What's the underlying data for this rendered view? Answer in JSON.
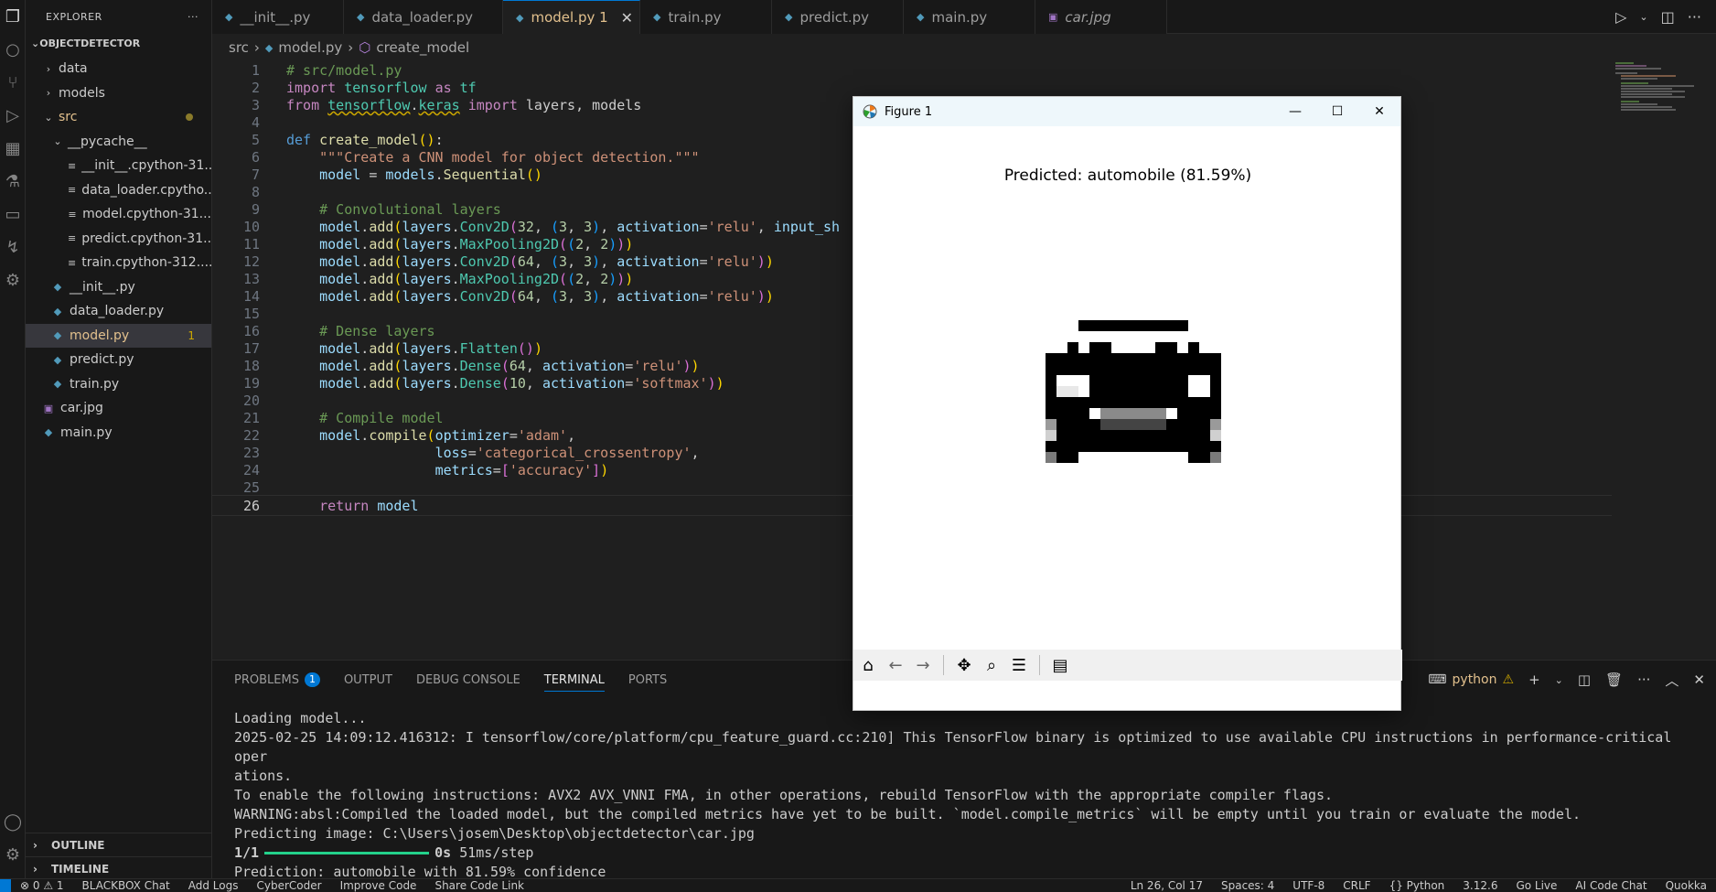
{
  "explorer": {
    "title": "EXPLORER",
    "more": "···",
    "root": "OBJECTDETECTOR",
    "items": [
      {
        "label": "data",
        "kind": "folder"
      },
      {
        "label": "models",
        "kind": "folder"
      },
      {
        "label": "src",
        "kind": "folder-open"
      },
      {
        "label": "__pycache__",
        "kind": "folder-open"
      },
      {
        "label": "__init__.cpython-31...",
        "kind": "file"
      },
      {
        "label": "data_loader.cpytho...",
        "kind": "file"
      },
      {
        "label": "model.cpython-31...",
        "kind": "file"
      },
      {
        "label": "predict.cpython-31...",
        "kind": "file"
      },
      {
        "label": "train.cpython-312....",
        "kind": "file"
      },
      {
        "label": "__init__.py",
        "kind": "py"
      },
      {
        "label": "data_loader.py",
        "kind": "py"
      },
      {
        "label": "model.py",
        "kind": "py",
        "badge": "1"
      },
      {
        "label": "predict.py",
        "kind": "py"
      },
      {
        "label": "train.py",
        "kind": "py"
      },
      {
        "label": "car.jpg",
        "kind": "img"
      },
      {
        "label": "main.py",
        "kind": "py"
      }
    ],
    "outline": "OUTLINE",
    "timeline": "TIMELINE"
  },
  "tabs": [
    {
      "label": "__init__.py"
    },
    {
      "label": "data_loader.py"
    },
    {
      "label": "model.py 1",
      "active": true
    },
    {
      "label": "train.py"
    },
    {
      "label": "predict.py"
    },
    {
      "label": "main.py"
    },
    {
      "label": "car.jpg"
    }
  ],
  "breadcrumb": {
    "folder": "src",
    "file": "model.py",
    "symbol": "create_model"
  },
  "editor": {
    "current_line": "26"
  },
  "panel": {
    "tabs": [
      "PROBLEMS",
      "OUTPUT",
      "DEBUG CONSOLE",
      "TERMINAL",
      "PORTS"
    ],
    "problems_count": "1",
    "terminal_name": "python",
    "terminal": {
      "l1": "Loading model...",
      "l2": "2025-02-25 14:09:12.416312: I tensorflow/core/platform/cpu_feature_guard.cc:210] This TensorFlow binary is optimized to use available CPU instructions in performance-critical oper",
      "l3": "ations.",
      "l4": "To enable the following instructions: AVX2 AVX_VNNI FMA, in other operations, rebuild TensorFlow with the appropriate compiler flags.",
      "l5": "WARNING:absl:Compiled the loaded model, but the compiled metrics have yet to be built. `model.compile_metrics` will be empty until you train or evaluate the model.",
      "l6": "Predicting image: C:\\Users\\josem\\Desktop\\objectdetector\\car.jpg",
      "step": "1/1",
      "step_time": "0s",
      "step_rate": "51ms/step",
      "l8": "Prediction: automobile with 81.59% confidence"
    }
  },
  "figure": {
    "title": "Figure 1",
    "prediction": "Predicted: automobile (81.59%)"
  },
  "status": {
    "errors": "⊗ 0 ⚠ 1",
    "items_left": [
      "BLACKBOX Chat",
      "Add Logs",
      "CyberCoder",
      "Improve Code",
      "Share Code Link"
    ],
    "items_right": [
      "Ln 26, Col 17",
      "Spaces: 4",
      "UTF-8",
      "CRLF",
      "{} Python",
      "3.12.6",
      "Go Live",
      "AI Code Chat",
      "Quokka"
    ]
  },
  "colors": {
    "accent": "#0078d4",
    "warning": "#cca700",
    "modified": "#e2c08d"
  }
}
